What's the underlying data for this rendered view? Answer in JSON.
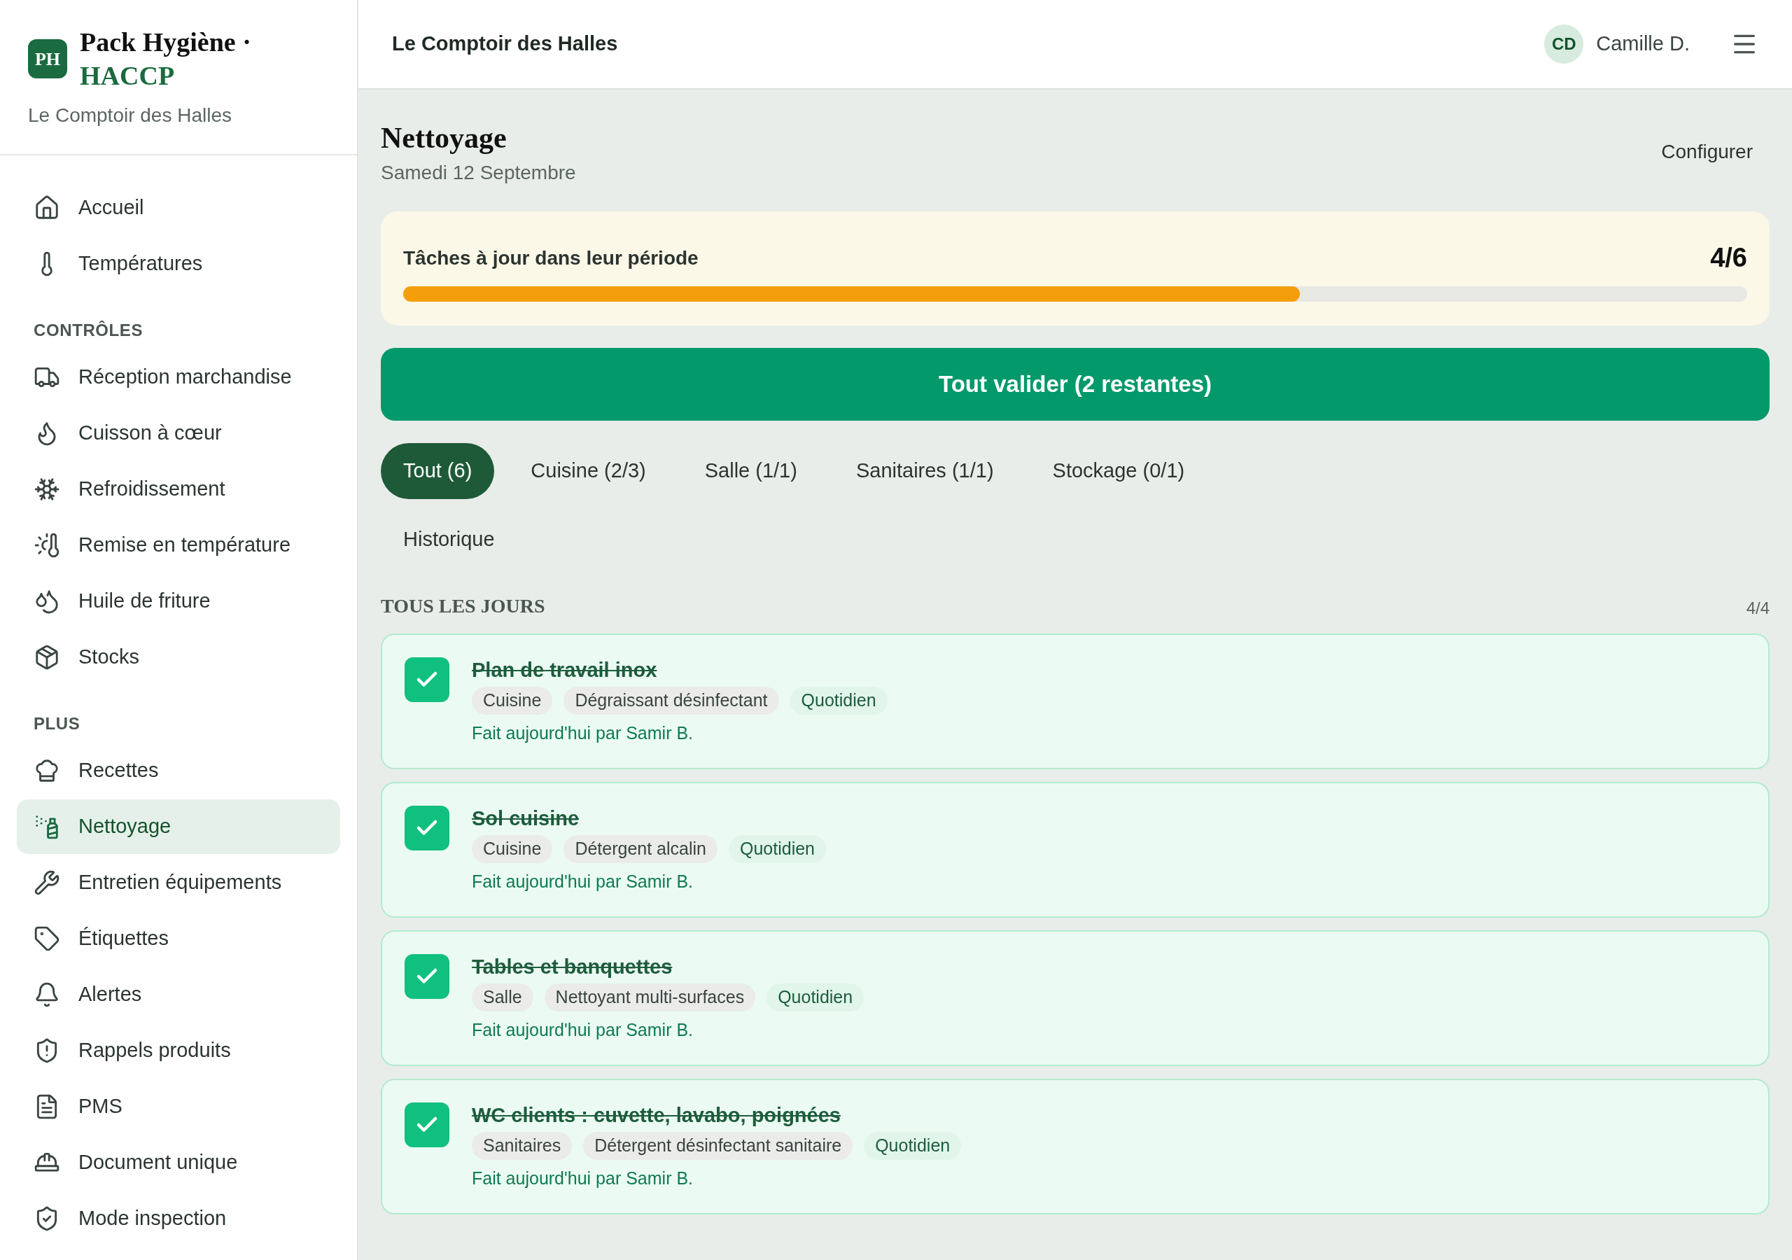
{
  "brand": {
    "logo": "PH",
    "title": "Pack Hygiène ·",
    "subtitle": "HACCP",
    "establishment": "Le Comptoir des Halles"
  },
  "sidebar": {
    "sections": [
      {
        "items": [
          {
            "label": "Accueil",
            "selected": false
          },
          {
            "label": "Températures",
            "selected": false
          }
        ]
      },
      {
        "heading": "CONTRÔLES",
        "items": [
          {
            "label": "Réception marchandise",
            "selected": false
          },
          {
            "label": "Cuisson à cœur",
            "selected": false
          },
          {
            "label": "Refroidissement",
            "selected": false
          },
          {
            "label": "Remise en température",
            "selected": false
          },
          {
            "label": "Huile de friture",
            "selected": false
          },
          {
            "label": "Stocks",
            "selected": false
          }
        ]
      },
      {
        "heading": "PLUS",
        "items": [
          {
            "label": "Recettes",
            "selected": false
          },
          {
            "label": "Nettoyage",
            "selected": true
          },
          {
            "label": "Entretien équipements",
            "selected": false
          },
          {
            "label": "Étiquettes",
            "selected": false
          },
          {
            "label": "Alertes",
            "selected": false
          },
          {
            "label": "Rappels produits",
            "selected": false
          },
          {
            "label": "PMS",
            "selected": false
          },
          {
            "label": "Document unique",
            "selected": false
          },
          {
            "label": "Mode inspection",
            "selected": false
          }
        ]
      }
    ]
  },
  "header": {
    "title": "Le Comptoir des Halles",
    "user": {
      "initials": "CD",
      "name": "Camille D."
    }
  },
  "page": {
    "title": "Nettoyage",
    "date": "Samedi 12 Septembre",
    "action": "Configurer"
  },
  "progress": {
    "label": "Tâches à jour dans leur période",
    "count": "4/6",
    "level": 0.667
  },
  "validate_button": "Tout valider (2 restantes)",
  "tabs": [
    {
      "label": "Tout (6)",
      "selected": true
    },
    {
      "label": "Cuisine (2/3)",
      "selected": false
    },
    {
      "label": "Salle (1/1)",
      "selected": false
    },
    {
      "label": "Sanitaires (1/1)",
      "selected": false
    },
    {
      "label": "Stockage (0/1)",
      "selected": false
    }
  ],
  "history_tab": "Historique",
  "section": {
    "title": "TOUS LES JOURS",
    "count": "4/4",
    "tasks": [
      {
        "title": "Plan de travail inox",
        "checked": true,
        "zone": "Cuisine",
        "product": "Dégraissant désinfectant",
        "frequency": "Quotidien",
        "done": "Fait aujourd'hui par Samir B."
      },
      {
        "title": "Sol cuisine",
        "checked": true,
        "zone": "Cuisine",
        "product": "Détergent alcalin",
        "frequency": "Quotidien",
        "done": "Fait aujourd'hui par Samir B."
      },
      {
        "title": "Tables et banquettes",
        "checked": true,
        "zone": "Salle",
        "product": "Nettoyant multi-surfaces",
        "frequency": "Quotidien",
        "done": "Fait aujourd'hui par Samir B."
      },
      {
        "title": "WC clients : cuvette, lavabo, poignées",
        "checked": true,
        "zone": "Sanitaires",
        "product": "Détergent désinfectant sanitaire",
        "frequency": "Quotidien",
        "done": "Fait aujourd'hui par Samir B."
      }
    ]
  }
}
